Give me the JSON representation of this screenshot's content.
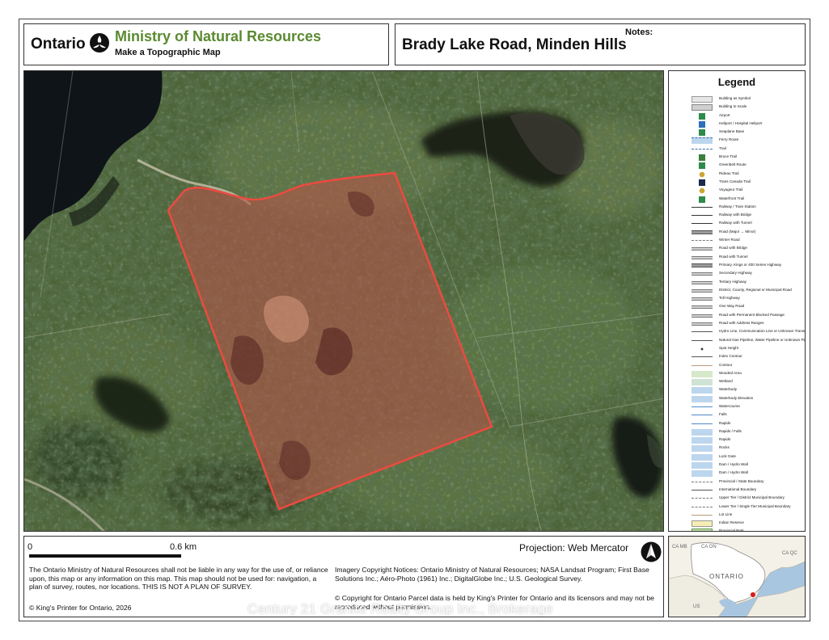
{
  "header": {
    "brand": "Ontario",
    "ministry": "Ministry of Natural Resources",
    "subtitle": "Make a Topographic Map",
    "place_title": "Brady Lake Road, Minden Hills",
    "notes_label": "Notes:"
  },
  "legend": {
    "title": "Legend",
    "items": [
      {
        "label": "Building as Symbol",
        "sym": "bldg"
      },
      {
        "label": "Building to Scale",
        "sym": "bldg2"
      },
      {
        "label": "Airport",
        "sym": "icon-green"
      },
      {
        "label": "Heliport / Hospital Heliport",
        "sym": "icon-blue"
      },
      {
        "label": "Seaplane Base",
        "sym": "icon-green"
      },
      {
        "label": "Ferry Route",
        "sym": "water-dash"
      },
      {
        "label": "Trail",
        "sym": "dash-blue"
      },
      {
        "label": "Bruce Trail",
        "sym": "icon-diamond"
      },
      {
        "label": "Greenbelt Route",
        "sym": "icon-green"
      },
      {
        "label": "Rideau Trail",
        "sym": "icon-circle"
      },
      {
        "label": "Trans Canada Trail",
        "sym": "icon-dark"
      },
      {
        "label": "Voyageur Trail",
        "sym": "icon-circle"
      },
      {
        "label": "Waterfront Trail",
        "sym": "icon-green"
      },
      {
        "label": "Railway / Train Station",
        "sym": "rail"
      },
      {
        "label": "Railway with Bridge",
        "sym": "rail"
      },
      {
        "label": "Railway with Tunnel",
        "sym": "rail"
      },
      {
        "label": "Road (Major → Minor)",
        "sym": "road-thick"
      },
      {
        "label": "Winter Road",
        "sym": "dash-grey"
      },
      {
        "label": "Road with Bridge",
        "sym": "road"
      },
      {
        "label": "Road with Tunnel",
        "sym": "road"
      },
      {
        "label": "Primary, Kings or 400 Series Highway",
        "sym": "road-thick"
      },
      {
        "label": "Secondary Highway",
        "sym": "road"
      },
      {
        "label": "Tertiary Highway",
        "sym": "road"
      },
      {
        "label": "District, County, Regional or Municipal Road",
        "sym": "road"
      },
      {
        "label": "Toll Highway",
        "sym": "road"
      },
      {
        "label": "One Way Road",
        "sym": "road"
      },
      {
        "label": "Road with Permanent Blocked Passage",
        "sym": "road"
      },
      {
        "label": "Road with Address Ranges",
        "sym": "road"
      },
      {
        "label": "Hydro Line, Communication Line or Unknown Transmission Line",
        "sym": "line"
      },
      {
        "label": "Natural Gas Pipeline, Water Pipeline or Unknown Pipeline",
        "sym": "line"
      },
      {
        "label": "Spot Height",
        "sym": "dot"
      },
      {
        "label": "Index Contour",
        "sym": "line"
      },
      {
        "label": "Contour",
        "sym": "line-light"
      },
      {
        "label": "Wooded Area",
        "sym": "green"
      },
      {
        "label": "Wetland",
        "sym": "green-blue"
      },
      {
        "label": "Waterbody",
        "sym": "water"
      },
      {
        "label": "Waterbody Elevation",
        "sym": "water"
      },
      {
        "label": "Watercourse",
        "sym": "water-line"
      },
      {
        "label": "Falls",
        "sym": "water-line"
      },
      {
        "label": "Rapids",
        "sym": "water-line"
      },
      {
        "label": "Rapids / Falls",
        "sym": "water"
      },
      {
        "label": "Rapids",
        "sym": "water"
      },
      {
        "label": "Rocks",
        "sym": "water"
      },
      {
        "label": "Lock Gate",
        "sym": "water"
      },
      {
        "label": "Dam / Hydro Wall",
        "sym": "water"
      },
      {
        "label": "Dam / Hydro Wall",
        "sym": "water"
      },
      {
        "label": "Provincial / State Boundary",
        "sym": "dash-grey"
      },
      {
        "label": "International Boundary",
        "sym": "line"
      },
      {
        "label": "Upper Tier / District Municipal Boundary",
        "sym": "dash-grey"
      },
      {
        "label": "Lower Tier / Single Tier Municipal Boundary",
        "sym": "dash-grey"
      },
      {
        "label": "Lot Line",
        "sym": "line-light"
      },
      {
        "label": "Indian Reserve",
        "sym": "yellow"
      },
      {
        "label": "Provincial Park",
        "sym": "green-park"
      },
      {
        "label": "National Park",
        "sym": "green-park"
      },
      {
        "label": "Conservation Reserve",
        "sym": "green-park"
      },
      {
        "label": "Military Lands",
        "sym": "peach"
      }
    ]
  },
  "footer": {
    "scale_zero": "0",
    "scale_end": "0.6 km",
    "projection": "Projection: Web Mercator",
    "disclaimer": "The Ontario Ministry of Natural Resources shall not be liable in any way for the use of, or reliance upon, this map or any information on this map.  This map should not be used for: navigation, a plan of survey, routes, nor locations. THIS IS NOT A PLAN OF SURVEY.",
    "copyright_kings": "© King's Printer for Ontario, 2026",
    "imagery_notice": "Imagery Copyright Notices: Ontario Ministry of Natural Resources; NASA Landsat Program; First Base Solutions Inc.; Aéro-Photo (1961) Inc.; DigitalGlobe Inc.; U.S. Geological Survey.",
    "parcel_notice": "© Copyright for Ontario Parcel data is held by King's Printer for Ontario and its licensors and may not be reproduced without permission."
  },
  "inset": {
    "label": "ONTARIO",
    "neighbor_labels": [
      "CA MB",
      "CA ON",
      "CA QC",
      "US"
    ]
  },
  "watermark": "Century 21 Granite Realty Group Inc., Brokerage",
  "colors": {
    "ministry_green": "#5a8a2f",
    "parcel_outline": "#e8473f",
    "parcel_fill": "#c8554a"
  }
}
